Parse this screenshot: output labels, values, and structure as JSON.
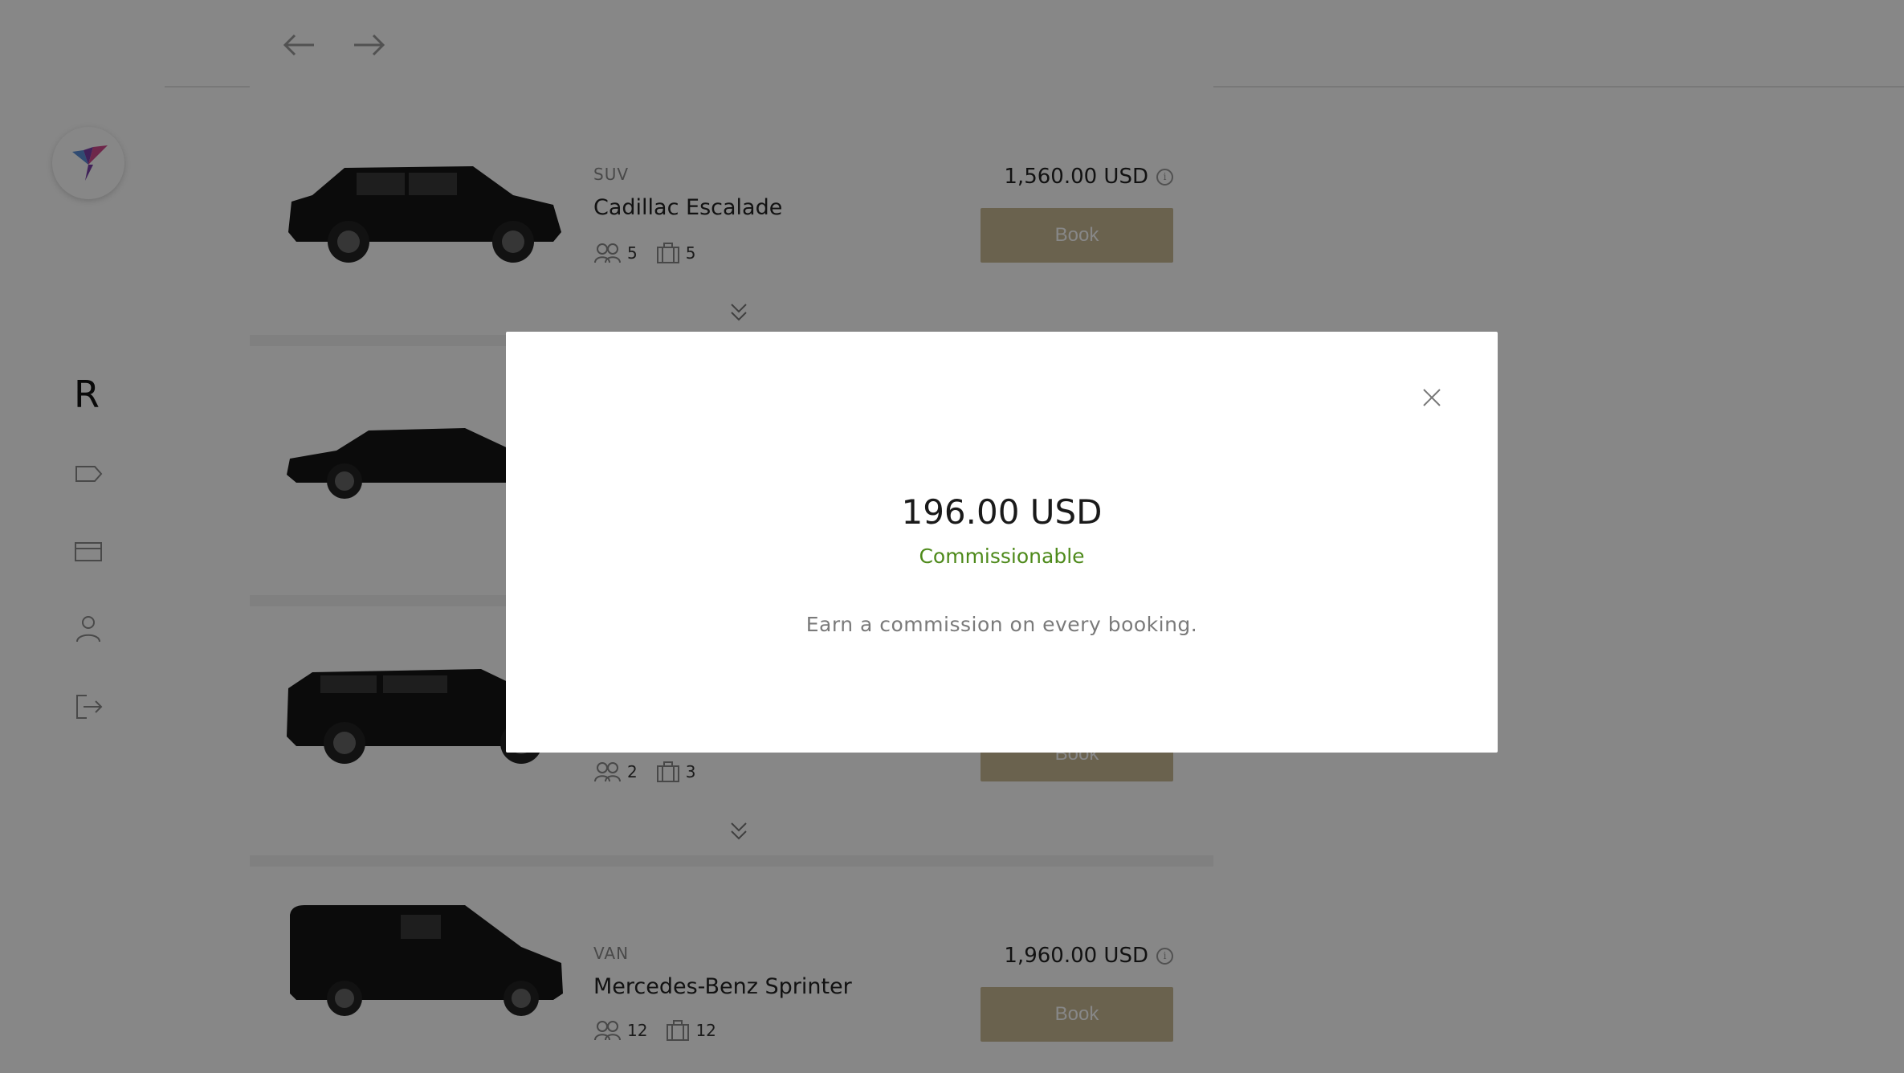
{
  "sidebar": {
    "brand_letter": "R",
    "items": [
      {
        "icon": "tag-icon"
      },
      {
        "icon": "card-icon"
      },
      {
        "icon": "user-icon"
      },
      {
        "icon": "logout-icon"
      }
    ]
  },
  "topbar": {
    "back_icon": "arrow-left-icon",
    "forward_icon": "arrow-right-icon"
  },
  "vehicles": [
    {
      "type": "SUV",
      "name": "Cadillac Escalade",
      "passengers": "5",
      "luggage": "5",
      "price": "1,560.00 USD",
      "button": "Book"
    },
    {
      "type": "",
      "name": "",
      "passengers": "",
      "luggage": "",
      "price": "",
      "button": ""
    },
    {
      "type": "",
      "name": "",
      "passengers": "2",
      "luggage": "3",
      "price": "",
      "button": "Book"
    },
    {
      "type": "VAN",
      "name": "Mercedes-Benz Sprinter",
      "passengers": "12",
      "luggage": "12",
      "price": "1,960.00 USD",
      "button": "Book"
    }
  ],
  "modal": {
    "amount": "196.00 USD",
    "status": "Commissionable",
    "description": "Earn a commission on every booking."
  },
  "colors": {
    "accent_button": "#c9b993",
    "commission_green": "#4e8a1b"
  }
}
